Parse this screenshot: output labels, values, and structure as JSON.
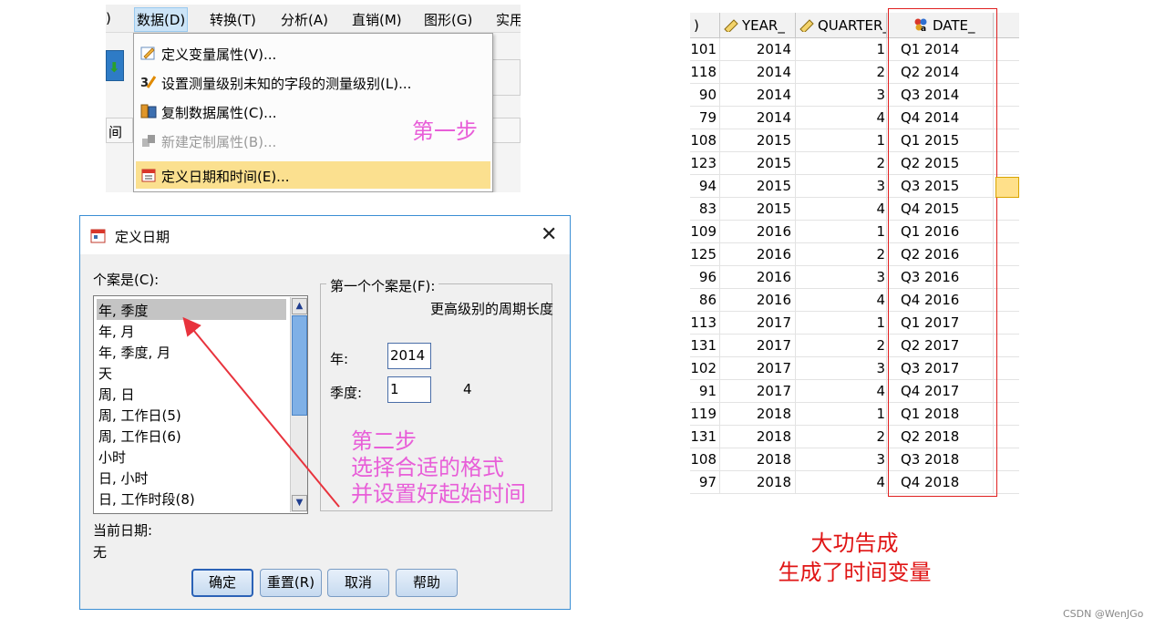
{
  "menubar": {
    "items": [
      {
        "label": ")"
      },
      {
        "label": "数据(D)"
      },
      {
        "label": "转换(T)"
      },
      {
        "label": "分析(A)"
      },
      {
        "label": "直销(M)"
      },
      {
        "label": "图形(G)"
      },
      {
        "label": "实用"
      }
    ]
  },
  "background": {
    "header_cell": "间"
  },
  "data_menu": {
    "items": [
      {
        "label": "定义变量属性(V)...",
        "icon": "pencil-icon"
      },
      {
        "label": "设置测量级别未知的字段的测量级别(L)...",
        "icon": "measure-level-icon"
      },
      {
        "label": "复制数据属性(C)...",
        "icon": "copy-properties-icon"
      },
      {
        "label": "新建定制属性(B)...",
        "icon": "custom-attribute-icon"
      },
      {
        "label": "定义日期和时间(E)...",
        "icon": "calendar-icon"
      }
    ],
    "step_note": "第一步"
  },
  "dialog": {
    "title": "定义日期",
    "close": "✕",
    "case_label": "个案是(C):",
    "case_options": [
      "年, 季度",
      "年, 月",
      "年, 季度, 月",
      "天",
      "周, 日",
      "周, 工作日(5)",
      "周, 工作日(6)",
      "小时",
      "日, 小时",
      "日, 工作时段(8)"
    ],
    "group_title": "第一个个案是(F):",
    "higher_period": "更高级别的周期长度",
    "year_label": "年:",
    "year_value": "2014",
    "quarter_label": "季度:",
    "quarter_value": "1",
    "quarter_period": "4",
    "current_date_label": "当前日期:",
    "current_date_value": "无",
    "buttons": {
      "ok": "确定",
      "reset": "重置(R)",
      "cancel": "取消",
      "help": "帮助"
    },
    "step_note": [
      "第二步",
      "选择合适的格式",
      "并设置好起始时间"
    ]
  },
  "grid": {
    "headers": [
      ")",
      "YEAR_",
      "QUARTER_",
      "DATE_"
    ],
    "rows": [
      [
        "101",
        "2014",
        "1",
        "Q1 2014"
      ],
      [
        "118",
        "2014",
        "2",
        "Q2 2014"
      ],
      [
        "90",
        "2014",
        "3",
        "Q3 2014"
      ],
      [
        "79",
        "2014",
        "4",
        "Q4 2014"
      ],
      [
        "108",
        "2015",
        "1",
        "Q1 2015"
      ],
      [
        "123",
        "2015",
        "2",
        "Q2 2015"
      ],
      [
        "94",
        "2015",
        "3",
        "Q3 2015"
      ],
      [
        "83",
        "2015",
        "4",
        "Q4 2015"
      ],
      [
        "109",
        "2016",
        "1",
        "Q1 2016"
      ],
      [
        "125",
        "2016",
        "2",
        "Q2 2016"
      ],
      [
        "96",
        "2016",
        "3",
        "Q3 2016"
      ],
      [
        "86",
        "2016",
        "4",
        "Q4 2016"
      ],
      [
        "113",
        "2017",
        "1",
        "Q1 2017"
      ],
      [
        "131",
        "2017",
        "2",
        "Q2 2017"
      ],
      [
        "102",
        "2017",
        "3",
        "Q3 2017"
      ],
      [
        "91",
        "2017",
        "4",
        "Q4 2017"
      ],
      [
        "119",
        "2018",
        "1",
        "Q1 2018"
      ],
      [
        "131",
        "2018",
        "2",
        "Q2 2018"
      ],
      [
        "108",
        "2018",
        "3",
        "Q3 2018"
      ],
      [
        "97",
        "2018",
        "4",
        "Q4 2018"
      ]
    ]
  },
  "done_note": [
    "大功告成",
    "生成了时间变量"
  ],
  "watermark": "CSDN @WenJGo",
  "colors": {
    "annotation_pink": "#e85ed8",
    "annotation_red": "#e01515",
    "highlight": "#fbe08f"
  }
}
